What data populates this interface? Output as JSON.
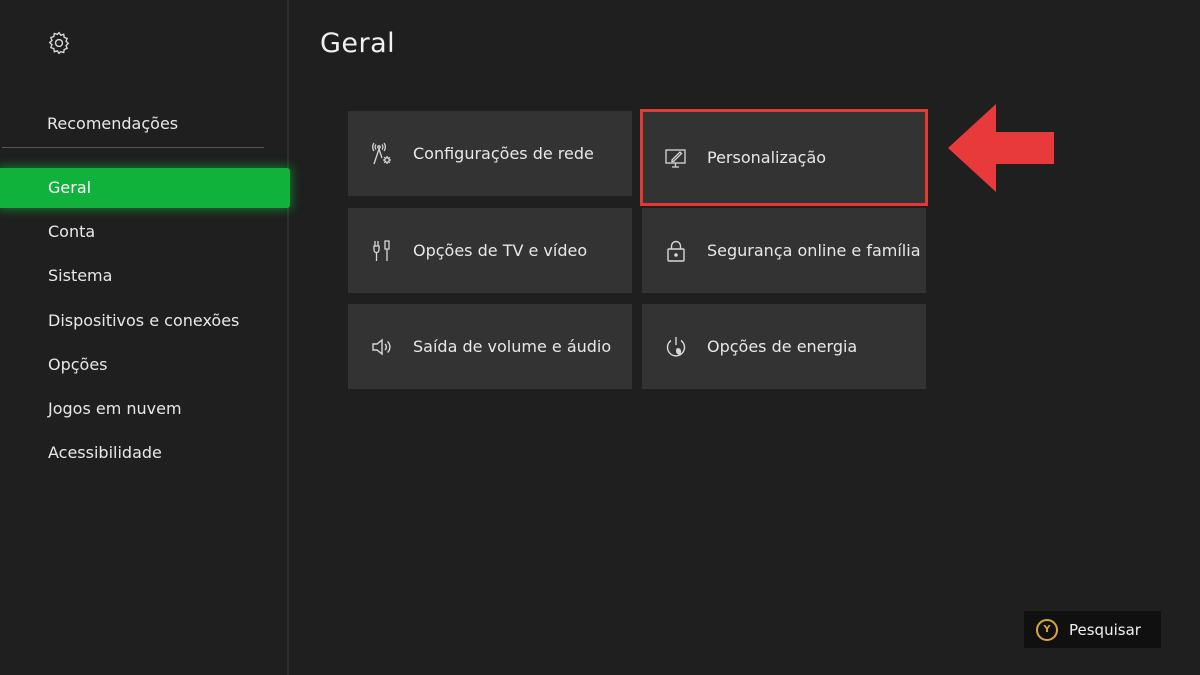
{
  "sidebar": {
    "recommendations_label": "Recomendações",
    "items": [
      {
        "label": "Geral",
        "active": true
      },
      {
        "label": "Conta"
      },
      {
        "label": "Sistema"
      },
      {
        "label": "Dispositivos e conexões"
      },
      {
        "label": "Opções"
      },
      {
        "label": "Jogos em nuvem"
      },
      {
        "label": "Acessibilidade"
      }
    ]
  },
  "main": {
    "title": "Geral",
    "tiles": [
      {
        "label": "Configurações de rede",
        "icon": "network-settings-icon"
      },
      {
        "label": "Personalização",
        "icon": "personalization-icon",
        "highlighted": true
      },
      {
        "label": "Opções de TV e vídeo",
        "icon": "tv-video-icon"
      },
      {
        "label": "Segurança online e família",
        "icon": "lock-icon"
      },
      {
        "label": "Saída de volume e áudio",
        "icon": "speaker-icon"
      },
      {
        "label": "Opções de energia",
        "icon": "power-icon"
      }
    ]
  },
  "footer": {
    "search_button_glyph": "Y",
    "search_label": "Pesquisar"
  },
  "colors": {
    "accent_green": "#10b23b",
    "highlight_red": "#e53935",
    "tile_bg": "#333333",
    "background": "#1f1f1f"
  }
}
